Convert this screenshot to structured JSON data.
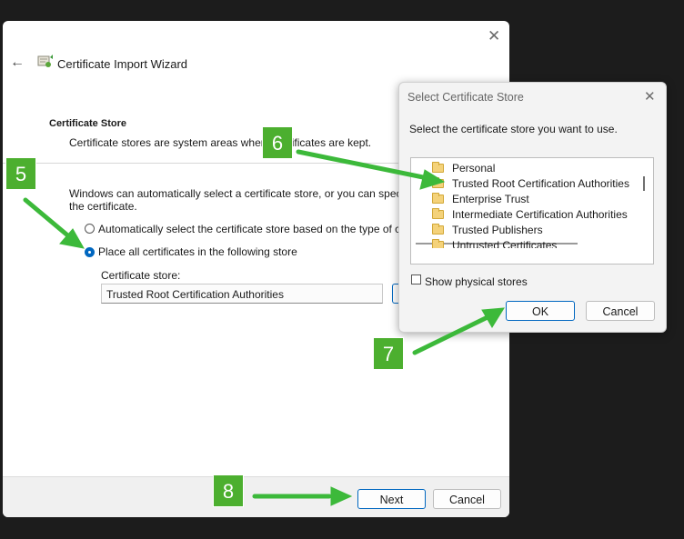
{
  "wizard": {
    "title": "Certificate Import Wizard",
    "section_title": "Certificate Store",
    "section_desc": "Certificate stores are system areas where certificates are kept.",
    "intro_line1": "Windows can automatically select a certificate store, or you can specify",
    "intro_line2": "the certificate.",
    "radio_auto": "Automatically select the certificate store based on the type of cer",
    "radio_place": "Place all certificates in the following store",
    "store_label": "Certificate store:",
    "store_value": "Trusted Root Certification Authorities",
    "next_label": "Next",
    "cancel_label": "Cancel"
  },
  "store_dialog": {
    "title": "Select Certificate Store",
    "prompt": "Select the certificate store you want to use.",
    "items": [
      "Personal",
      "Trusted Root Certification Authorities",
      "Enterprise Trust",
      "Intermediate Certification Authorities",
      "Trusted Publishers",
      "Untrusted Certificates"
    ],
    "show_physical": "Show physical stores",
    "ok_label": "OK",
    "cancel_label": "Cancel"
  },
  "annotations": {
    "step5": "5",
    "step6": "6",
    "step7": "7",
    "step8": "8"
  },
  "colors": {
    "accent": "#0067c0",
    "annotation_green": "#4caf2f",
    "arrow_green": "#3cb93a",
    "backdrop": "#1c1c1c"
  }
}
